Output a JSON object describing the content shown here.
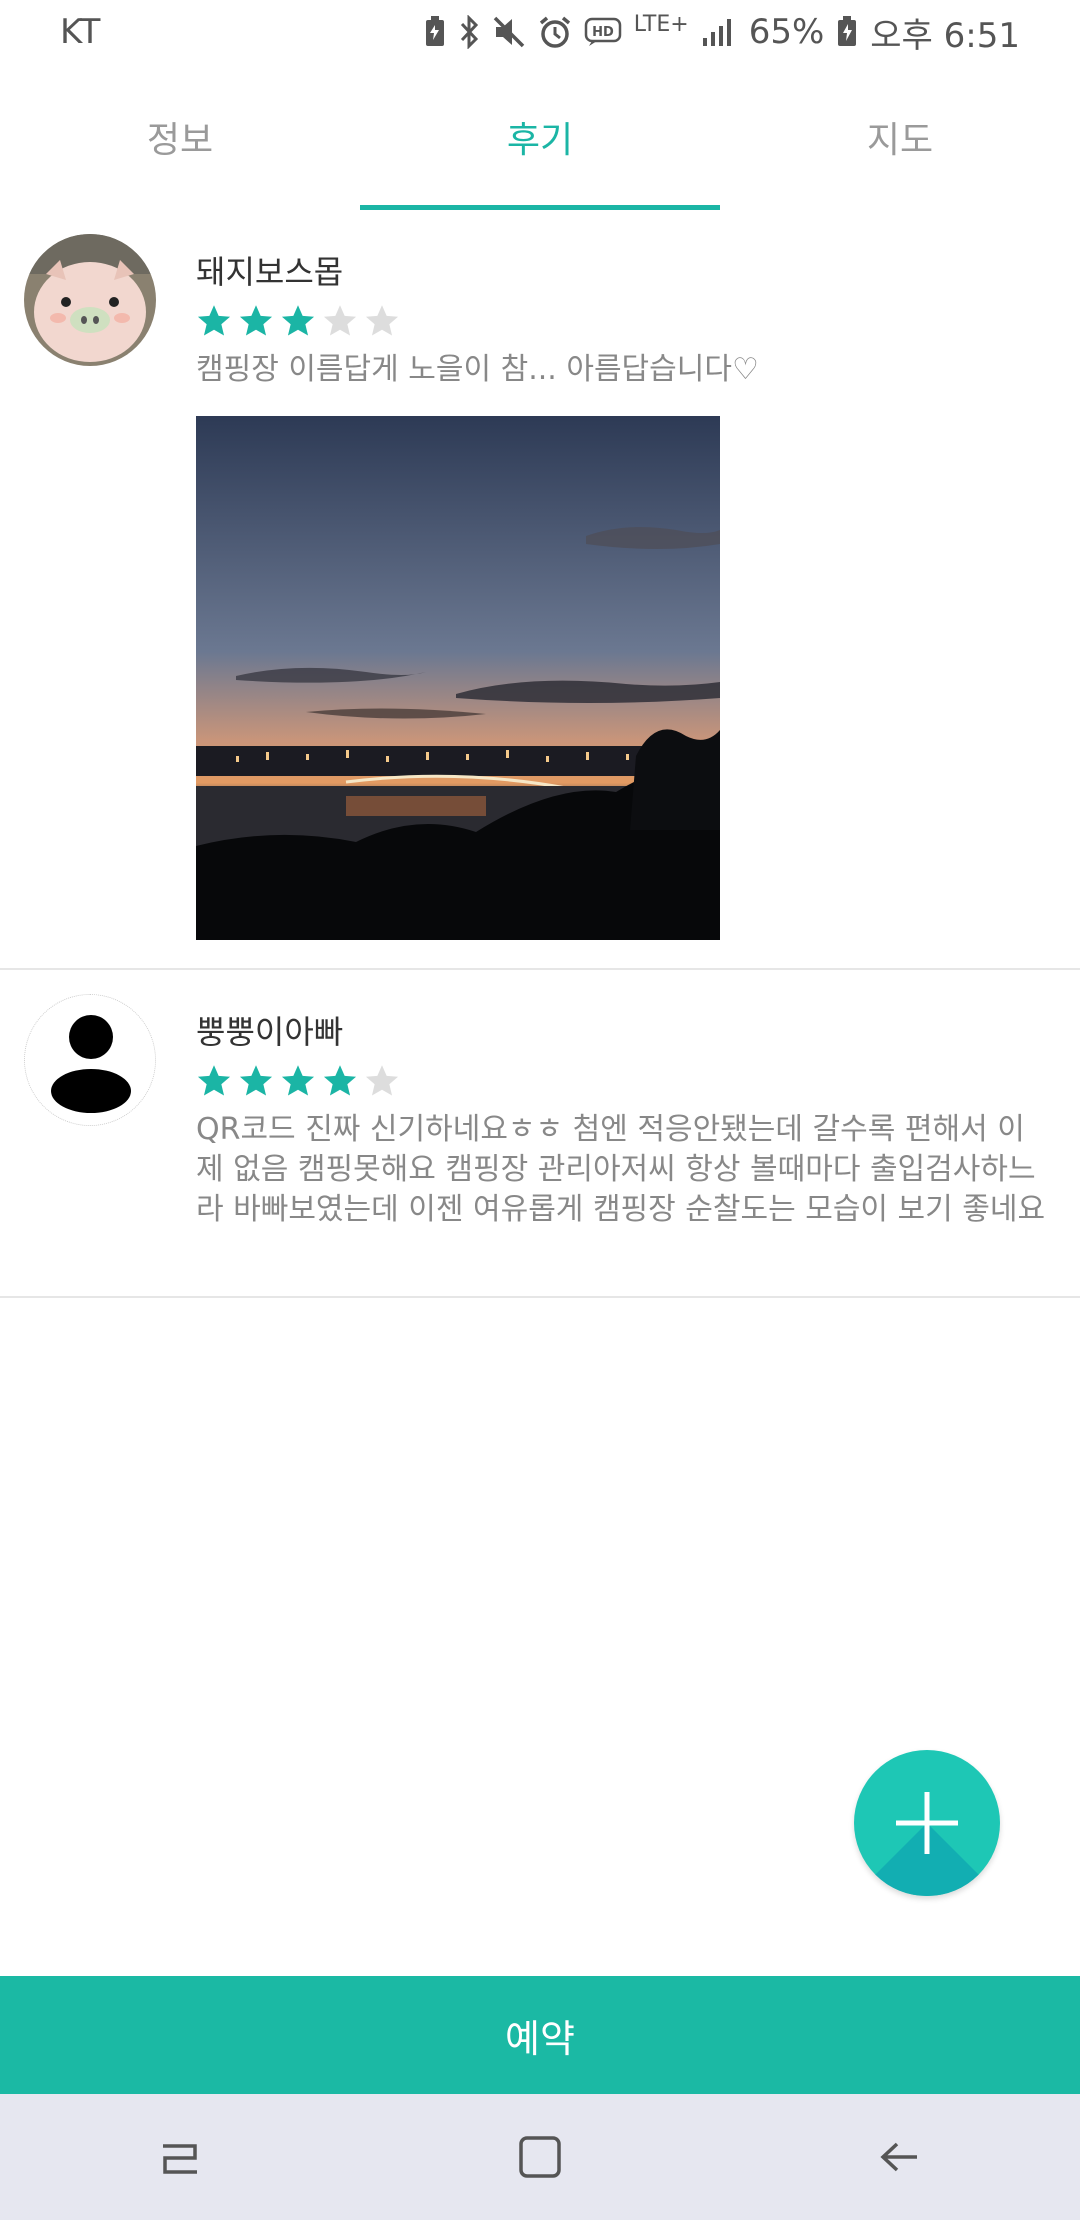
{
  "status_bar": {
    "carrier": "KT",
    "network": "LTE+",
    "battery": "65%",
    "time": "오후 6:51",
    "icons": [
      "battery-saver-icon",
      "bluetooth-icon",
      "mute-icon",
      "alarm-icon",
      "hd-icon",
      "signal-icon",
      "battery-icon"
    ]
  },
  "tabs": [
    {
      "label": "정보",
      "active": false
    },
    {
      "label": "후기",
      "active": true
    },
    {
      "label": "지도",
      "active": false
    }
  ],
  "reviews": [
    {
      "name": "돼지보스몹",
      "rating": 3,
      "max_rating": 5,
      "text": "캠핑장 이름답게 노을이 참... 아름답습니다♡",
      "has_photo": true
    },
    {
      "name": "뿡뿡이아빠",
      "rating": 4,
      "max_rating": 5,
      "text": "QR코드 진짜 신기하네요ㅎㅎ 첨엔 적응안됐는데 갈수록 편해서 이제 없음 캠핑못해요 캠핑장 관리아저씨 항상 볼때마다 출입검사하느라 바빠보였는데 이젠 여유롭게 캠핑장 순찰도는 모습이 보기 좋네요",
      "has_photo": false
    }
  ],
  "reserve_button": {
    "label": "예약"
  },
  "colors": {
    "accent": "#1bb5a5",
    "star_on": "#1bb5a5",
    "star_off": "#dddddd",
    "reserve_bg": "#1bb9a4",
    "navbar_bg": "#e6e7f0"
  },
  "fab": {
    "icon": "plus-icon"
  },
  "navbar": {
    "icons": [
      "recents-icon",
      "home-icon",
      "back-icon"
    ]
  }
}
